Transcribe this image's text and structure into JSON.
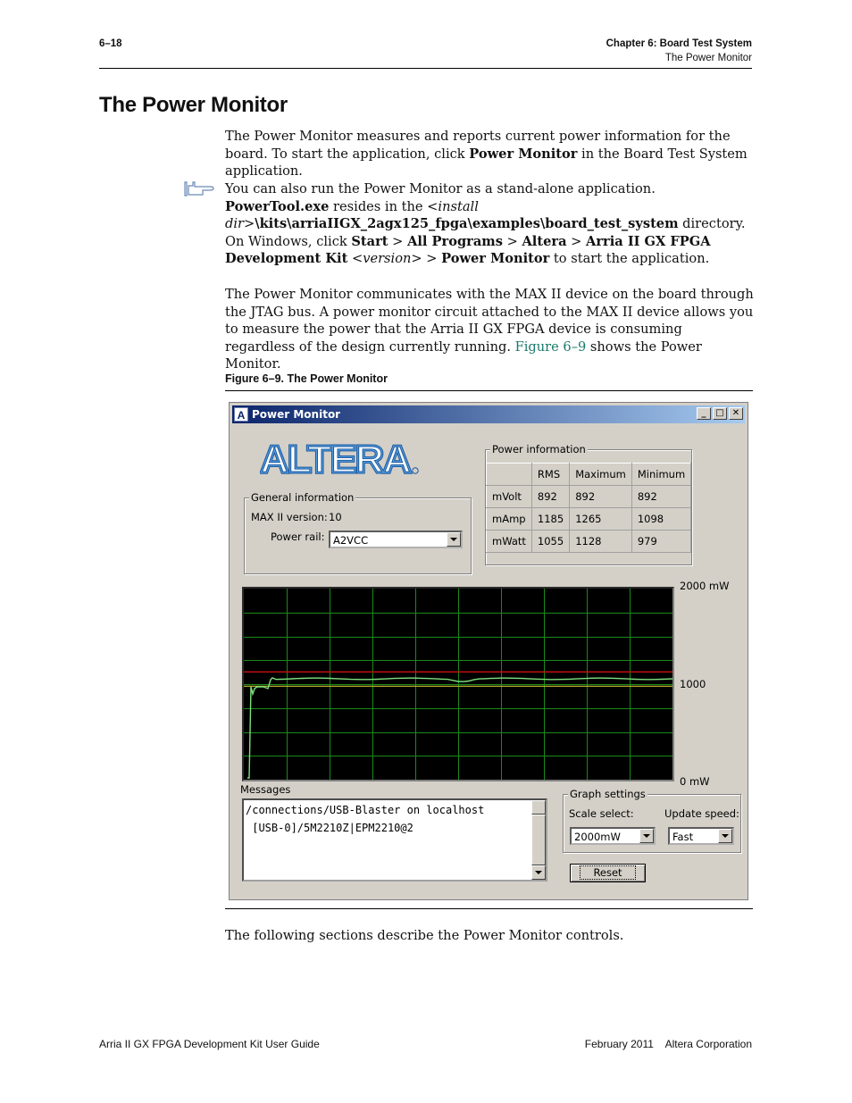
{
  "header": {
    "page_number": "6–18",
    "chapter": "Chapter 6:  Board Test System",
    "section": "The Power Monitor"
  },
  "title": "The Power Monitor",
  "intro": {
    "t1": "The Power Monitor measures and reports current power information for the board. To start the application, click ",
    "b1": "Power Monitor",
    "t2": " in the Board Test System application."
  },
  "note": {
    "t1": "You can also run the Power Monitor as a stand-alone application. ",
    "b1": "PowerTool.exe",
    "t2": " resides in the <",
    "i1": "install dir",
    "t3": ">",
    "b2": "\\kits\\arriaIIGX_2agx125_fpga\\examples\\board_test_system",
    "t4": " directory. On Windows, click ",
    "b3": "Start",
    "t5": " > ",
    "b4": "All Programs",
    "t6": " > ",
    "b5": "Altera",
    "t7": " > ",
    "b6": "Arria II GX FPGA Development Kit",
    "t8": " <",
    "i2": "version",
    "t9": "> > ",
    "b7": "Power Monitor",
    "t10": " to start the application."
  },
  "body2": {
    "t1": "The Power Monitor communicates with the MAX II device on the board through the JTAG bus. A power monitor circuit attached to the MAX II device allows you to measure the power that the Arria II GX FPGA device is consuming regardless of the design currently running. ",
    "link": "Figure 6–9",
    "t2": " shows the Power Monitor."
  },
  "figure_caption": "Figure 6–9.  The Power Monitor",
  "window": {
    "title": "Power Monitor",
    "logo_text": "ALTERA",
    "general": {
      "label": "General information",
      "max_version_label": "MAX II version:",
      "max_version_value": "10",
      "power_rail_label": "Power rail:",
      "power_rail_value": "A2VCC"
    },
    "power_info": {
      "label": "Power information",
      "columns": [
        "RMS",
        "Maximum",
        "Minimum"
      ],
      "rows": [
        {
          "name": "mVolt",
          "values": [
            "892",
            "892",
            "892"
          ]
        },
        {
          "name": "mAmp",
          "values": [
            "1185",
            "1265",
            "1098"
          ]
        },
        {
          "name": "mWatt",
          "values": [
            "1055",
            "1128",
            "979"
          ]
        }
      ]
    },
    "graph": {
      "top_label": "2000 mW",
      "mid_label": "1000",
      "bottom_label": "0 mW",
      "scale_max_mw": 2000,
      "red_line_mw": 1128,
      "grid_color": "#1a8a1a",
      "trace_color": "#7ee27e",
      "red_color": "#cc1111",
      "yellow_color": "#c8c830"
    },
    "messages": {
      "label": "Messages",
      "line1": "/connections/USB-Blaster on localhost",
      "line2": " [USB-0]/5M2210Z|EPM2210@2"
    },
    "graph_settings": {
      "label": "Graph settings",
      "scale_label": "Scale select:",
      "scale_value": "2000mW",
      "speed_label": "Update speed:",
      "speed_value": "Fast"
    },
    "reset_label": "Reset"
  },
  "closing": "The following sections describe the Power Monitor controls.",
  "footer": {
    "left": "Arria II GX FPGA Development Kit User Guide",
    "right": "February 2011    Altera Corporation"
  }
}
